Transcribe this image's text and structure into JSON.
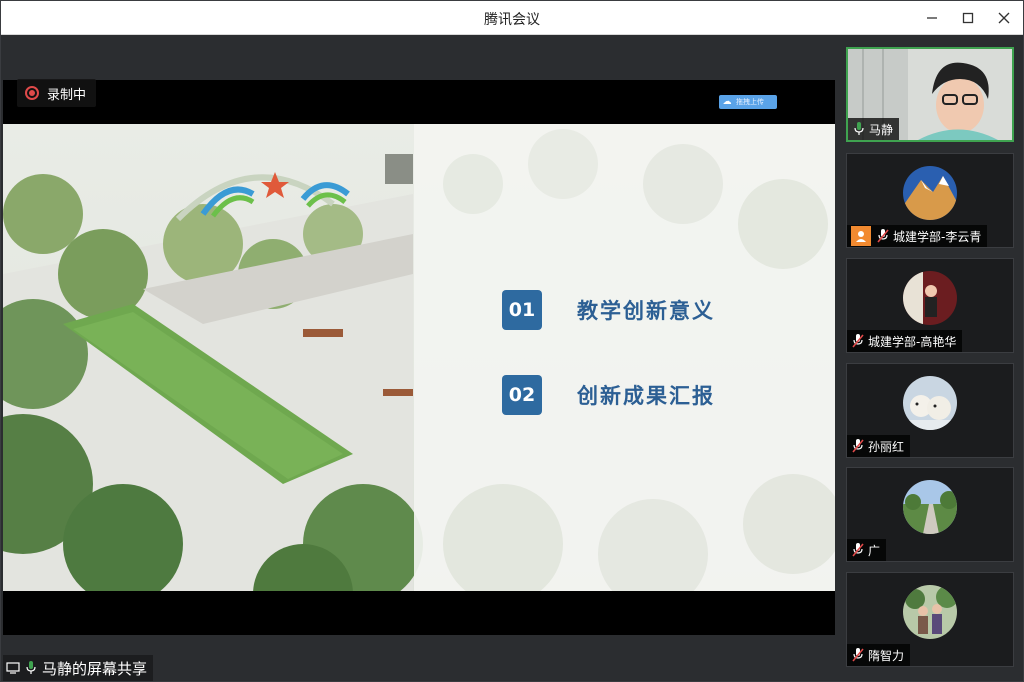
{
  "window": {
    "title": "腾讯会议"
  },
  "recording": {
    "label": "录制中"
  },
  "slide": {
    "upload_label": "拖拽上传",
    "agenda": [
      {
        "num": "01",
        "text": "教学创新意义"
      },
      {
        "num": "02",
        "text": "创新成果汇报"
      }
    ]
  },
  "share_label": "马静的屏幕共享",
  "participants": [
    {
      "name": "马静",
      "mic": "on",
      "active": true,
      "video": true
    },
    {
      "name": "城建学部-李云青",
      "mic": "muted",
      "host": true
    },
    {
      "name": "城建学部-高艳华",
      "mic": "muted"
    },
    {
      "name": "孙丽红",
      "mic": "muted"
    },
    {
      "name": "广",
      "mic": "muted"
    },
    {
      "name": "隋智力",
      "mic": "muted"
    }
  ],
  "colors": {
    "accent_green": "#3fa350",
    "slide_blue": "#2e6aa0",
    "muted_red": "#e04a4a"
  }
}
